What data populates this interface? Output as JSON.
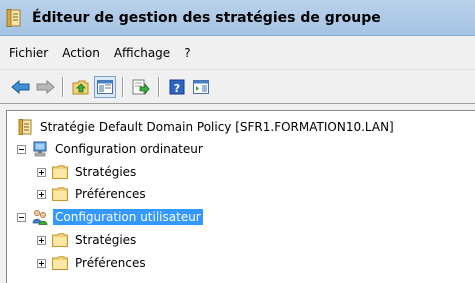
{
  "window": {
    "title": "Éditeur de gestion des stratégies de groupe",
    "title_icon": "gpo-editor-icon"
  },
  "menu": {
    "items": [
      {
        "label": "Fichier"
      },
      {
        "label": "Action"
      },
      {
        "label": "Affichage"
      },
      {
        "label": "?"
      }
    ]
  },
  "toolbar": {
    "buttons": [
      {
        "icon": "back-arrow-icon"
      },
      {
        "icon": "forward-arrow-icon"
      },
      {
        "icon": "up-folder-icon"
      },
      {
        "icon": "show-hide-console-tree-icon"
      },
      {
        "icon": "export-list-icon"
      },
      {
        "icon": "help-icon"
      },
      {
        "icon": "action-pane-icon"
      }
    ]
  },
  "tree": {
    "root": {
      "label": "Stratégie Default Domain Policy [SFR1.FORMATION10.LAN]",
      "icon": "policy-document-icon"
    },
    "computer": {
      "label": "Configuration ordinateur",
      "icon": "computer-icon",
      "children": [
        {
          "label": "Stratégies",
          "icon": "folder-icon"
        },
        {
          "label": "Préférences",
          "icon": "folder-icon"
        }
      ]
    },
    "user": {
      "label": "Configuration utilisateur",
      "icon": "users-icon",
      "selected": true,
      "children": [
        {
          "label": "Stratégies",
          "icon": "folder-icon"
        },
        {
          "label": "Préférences",
          "icon": "folder-icon"
        }
      ]
    }
  },
  "colors": {
    "selection": "#3399ff",
    "title_gradient_top": "#b9d1ea",
    "folder": "#f3d37a"
  }
}
